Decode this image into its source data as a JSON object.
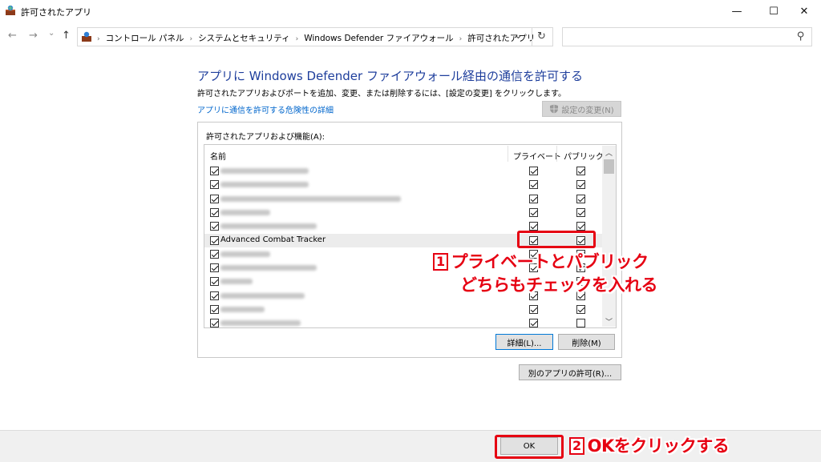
{
  "window": {
    "title": "許可されたアプリ",
    "min_glyph": "—",
    "max_glyph": "☐",
    "close_glyph": "✕"
  },
  "nav": {
    "back_glyph": "←",
    "forward_glyph": "→",
    "recent_glyph": "⌄",
    "up_glyph": "↑",
    "breadcrumbs": [
      "コントロール パネル",
      "システムとセキュリティ",
      "Windows Defender ファイアウォール",
      "許可されたアプリ"
    ],
    "dropdown_glyph": "⌄",
    "refresh_glyph": "↻",
    "search_placeholder": "",
    "search_glyph": "⚲"
  },
  "main": {
    "heading": "アプリに Windows Defender ファイアウォール経由の通信を許可する",
    "subtext": "許可されたアプリおよびポートを追加、変更、または削除するには、[設定の変更] をクリックします。",
    "risk_link": "アプリに通信を許可する危険性の詳細",
    "change_settings_label": "設定の変更(N)",
    "group_label": "許可されたアプリおよび機能(A):",
    "columns": {
      "name": "名前",
      "private": "プライベート",
      "public": "パブリック"
    },
    "rows": [
      {
        "name": "",
        "enabled": true,
        "private": true,
        "public": true
      },
      {
        "name": "",
        "enabled": true,
        "private": true,
        "public": true
      },
      {
        "name": "",
        "enabled": true,
        "private": true,
        "public": true
      },
      {
        "name": "",
        "enabled": true,
        "private": true,
        "public": true
      },
      {
        "name": "",
        "enabled": true,
        "private": true,
        "public": true
      },
      {
        "name": "Advanced Combat Tracker",
        "enabled": true,
        "private": true,
        "public": true
      },
      {
        "name": "",
        "enabled": true,
        "private": true,
        "public": true
      },
      {
        "name": "",
        "enabled": true,
        "private": true,
        "public": true
      },
      {
        "name": "",
        "enabled": true,
        "private": true,
        "public": true
      },
      {
        "name": "",
        "enabled": true,
        "private": true,
        "public": true
      },
      {
        "name": "",
        "enabled": true,
        "private": true,
        "public": true
      },
      {
        "name": "",
        "enabled": true,
        "private": true,
        "public": false
      }
    ],
    "details_label": "詳細(L)...",
    "remove_label": "削除(M)",
    "other_app_label": "別のアプリの許可(R)..."
  },
  "footer": {
    "ok_label": "OK"
  },
  "annotations": {
    "step1_num": "1",
    "step1_line1": "プライベートとパブリック",
    "step1_line2": "どちらもチェックを入れる",
    "step2_num": "2",
    "step2_text": "OKをクリックする",
    "color": "#e60012"
  }
}
